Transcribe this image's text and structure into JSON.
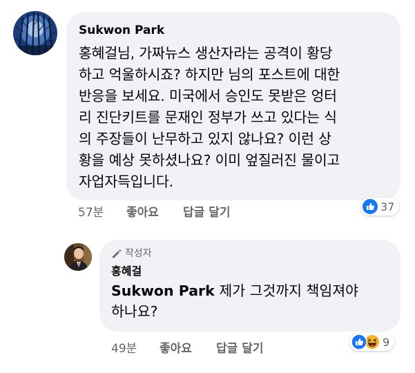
{
  "comment": {
    "author": "Sukwon Park",
    "text": "홍혜걸님, 가짜뉴스 생산자라는 공격이 황당\n하고 억울하시죠? 하지만 님의 포스트에 대한\n반응을 보세요. 미국에서 승인도 못받은 엉터\n리 진단키트를 문재인 정부가 쓰고 있다는 식\n의 주장들이 난무하고 있지 않나요? 이런 상\n황을 예상 못하셨나요? 이미 엎질러진 물이고\n자업자득입니다.",
    "time": "57분",
    "like_label": "좋아요",
    "reply_label": "답글 달기",
    "reaction_count": "37",
    "reactions": [
      "like-icon"
    ],
    "avatar_icon": "forest-avatar"
  },
  "reply": {
    "author_badge": "작성자",
    "author": "홍혜걸",
    "mention": "Sukwon Park",
    "text": "제가 그것까지 책임져야\n하나요?",
    "time": "49분",
    "like_label": "좋아요",
    "reply_label": "답글 달기",
    "reaction_count": "9",
    "reactions": [
      "like-icon",
      "haha-icon"
    ],
    "avatar_icon": "person-avatar"
  },
  "colors": {
    "bubble": "#f0f2f5",
    "like_blue": "#1877f2",
    "haha_yellow": "#f7b125",
    "meta_gray": "#65676b",
    "text": "#050505"
  }
}
